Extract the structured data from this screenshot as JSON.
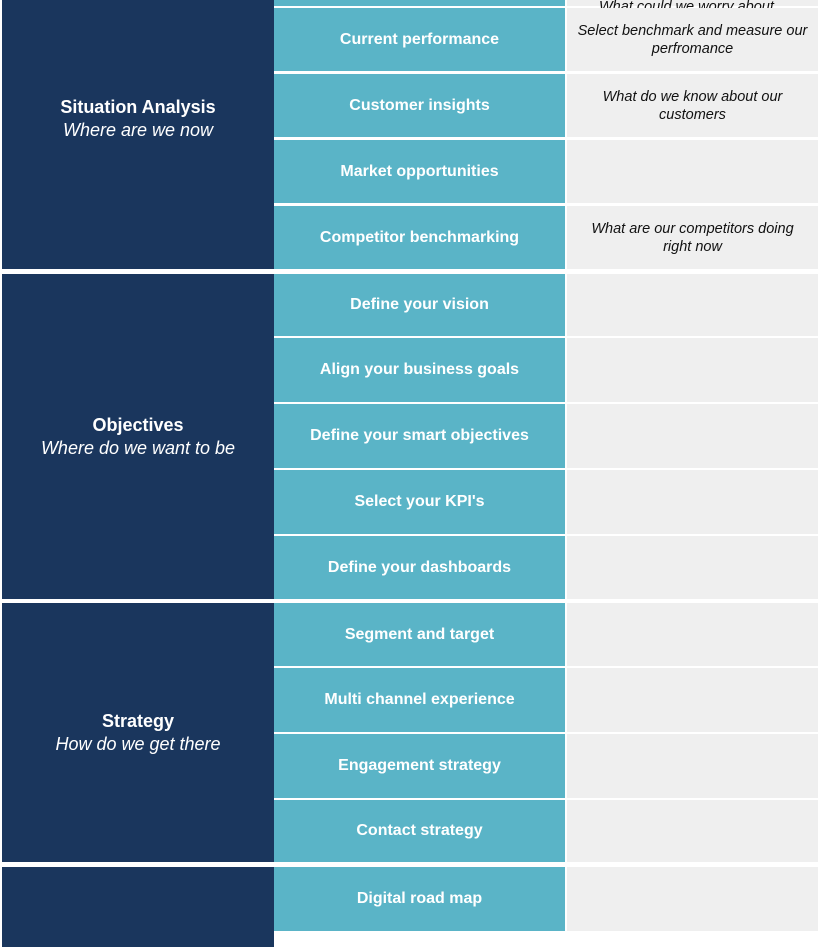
{
  "colors": {
    "phase_bg": "#1a365d",
    "step_bg": "#5ab4c7",
    "note_bg": "#efefef",
    "separator": "#ffffff"
  },
  "cut_off_top_row": {
    "note": "What could we worry about..."
  },
  "sections": [
    {
      "title": "Situation Analysis",
      "subtitle": "Where are we now",
      "rows": [
        {
          "step": "Current performance",
          "note": "Select benchmark and measure our perfromance"
        },
        {
          "step": "Customer insights",
          "note": "What do we know about our customers"
        },
        {
          "step": "Market opportunities",
          "note": ""
        },
        {
          "step": "Competitor benchmarking",
          "note": "What are our competitors doing right now"
        }
      ]
    },
    {
      "title": "Objectives",
      "subtitle": "Where do we want to be",
      "rows": [
        {
          "step": "Define your vision",
          "note": ""
        },
        {
          "step": "Align your business goals",
          "note": ""
        },
        {
          "step": "Define your smart objectives",
          "note": ""
        },
        {
          "step": "Select your KPI's",
          "note": ""
        },
        {
          "step": "Define your dashboards",
          "note": ""
        }
      ]
    },
    {
      "title": "Strategy",
      "subtitle": "How do we get there",
      "rows": [
        {
          "step": "Segment and target",
          "note": ""
        },
        {
          "step": "Multi channel experience",
          "note": ""
        },
        {
          "step": "Engagement strategy",
          "note": ""
        },
        {
          "step": "Contact strategy",
          "note": ""
        }
      ]
    },
    {
      "title": "",
      "subtitle": "",
      "rows": [
        {
          "step": "Digital road map",
          "note": ""
        }
      ]
    }
  ]
}
